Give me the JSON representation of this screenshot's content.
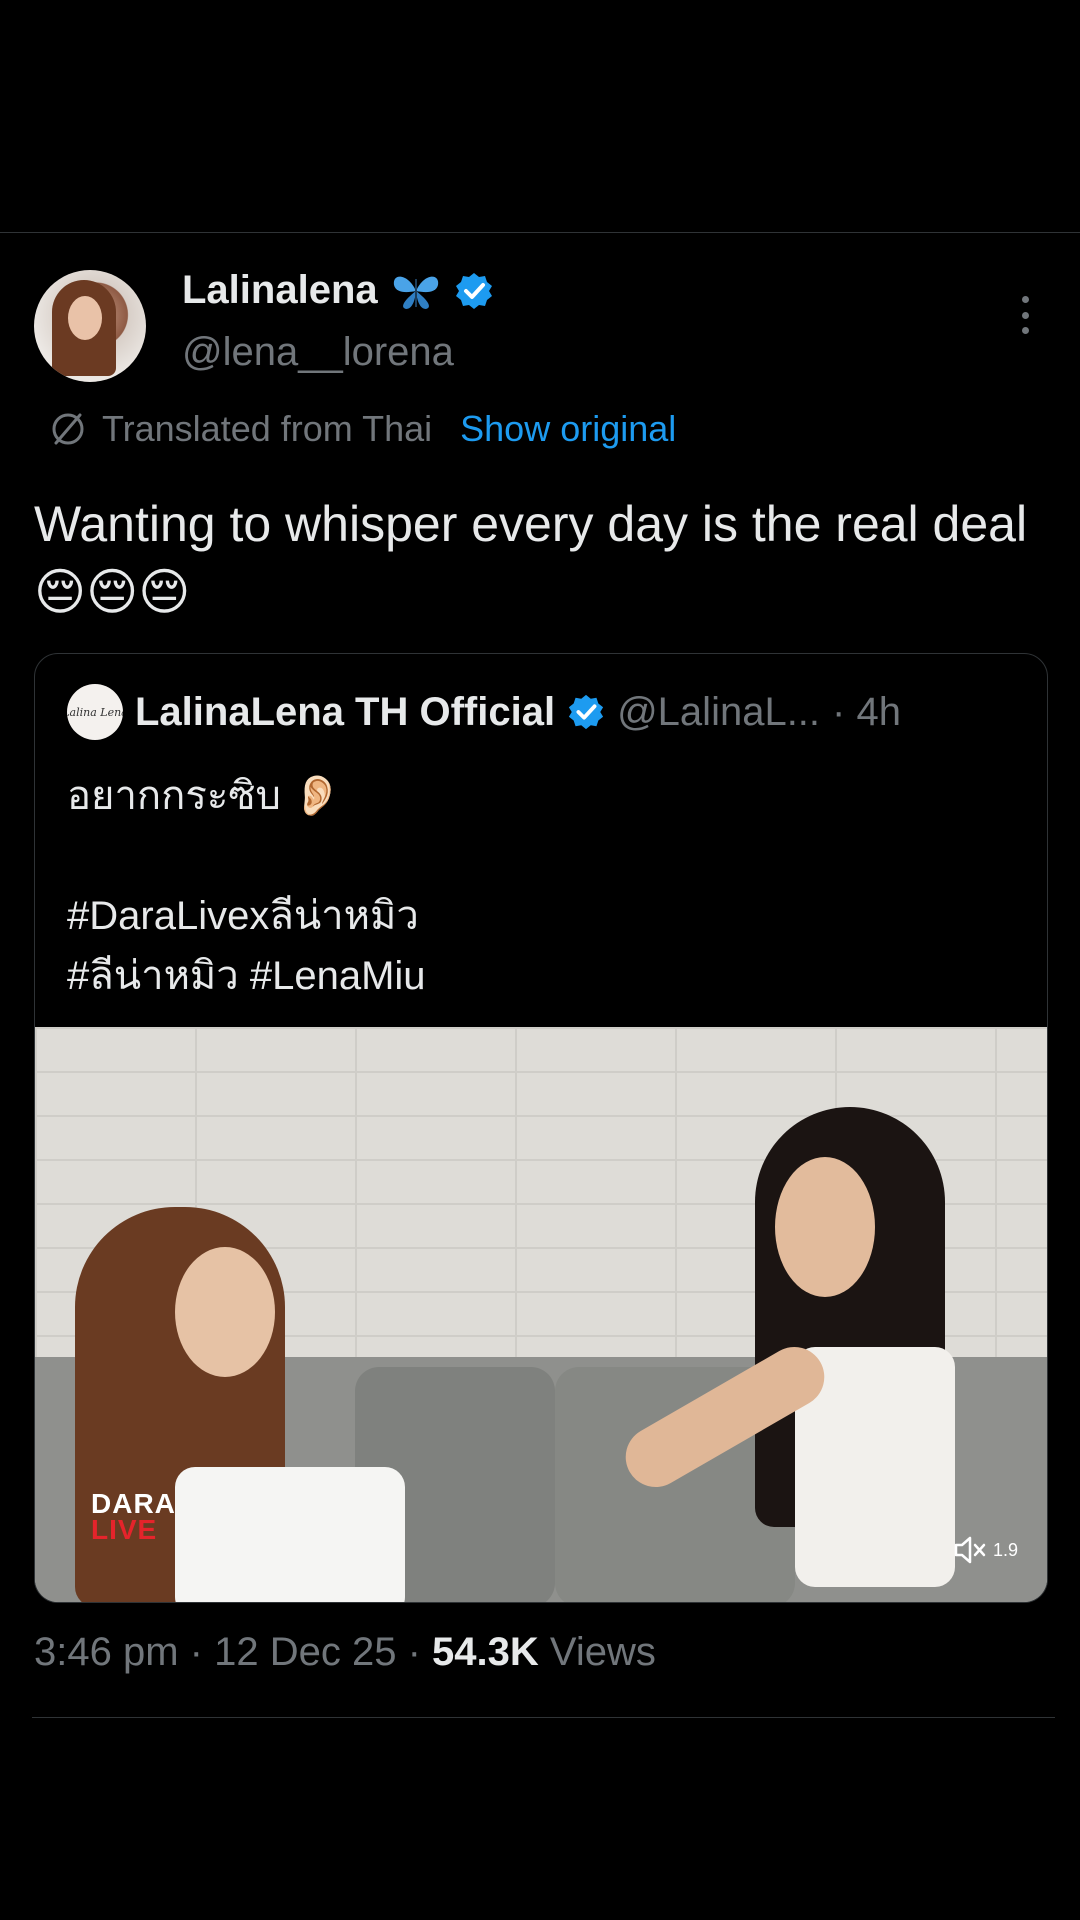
{
  "tweet": {
    "display_name": "Lalinalena",
    "handle": "@lena__lorena",
    "translation_label": "Translated from Thai",
    "show_original_label": "Show original",
    "text": "Wanting to whisper every day is the real deal",
    "emojis": "😔😔😔",
    "icons": {
      "butterfly": "butterfly-icon",
      "verified": "verified-badge-icon",
      "more": "more-options-icon",
      "translate": "translate-icon"
    }
  },
  "quote": {
    "display_name": "LalinaLena TH Official",
    "handle": "@LalinaL...",
    "time": "· 4h",
    "avatar_text": "Lalina Lena",
    "text": "อยากกระซิบ 👂🏻\n\n#DaraLivexลีน่าหมิว\n#ลีน่าหมิว #LenaMiu"
  },
  "media": {
    "logo_line1": "DARA",
    "logo_line2": "LIVE",
    "playback_rate": "1.9",
    "mute_icon": "speaker-muted-icon"
  },
  "footer": {
    "time": "3:46 pm",
    "date": "12 Dec 25",
    "views_count": "54.3K",
    "views_label": "Views"
  },
  "colors": {
    "background": "#000000",
    "text_primary": "#e7e9ea",
    "text_secondary": "#71767b",
    "link": "#1d9bf0",
    "verified": "#1d9bf0",
    "divider": "#2f3336",
    "dara_red": "#e5242b"
  }
}
